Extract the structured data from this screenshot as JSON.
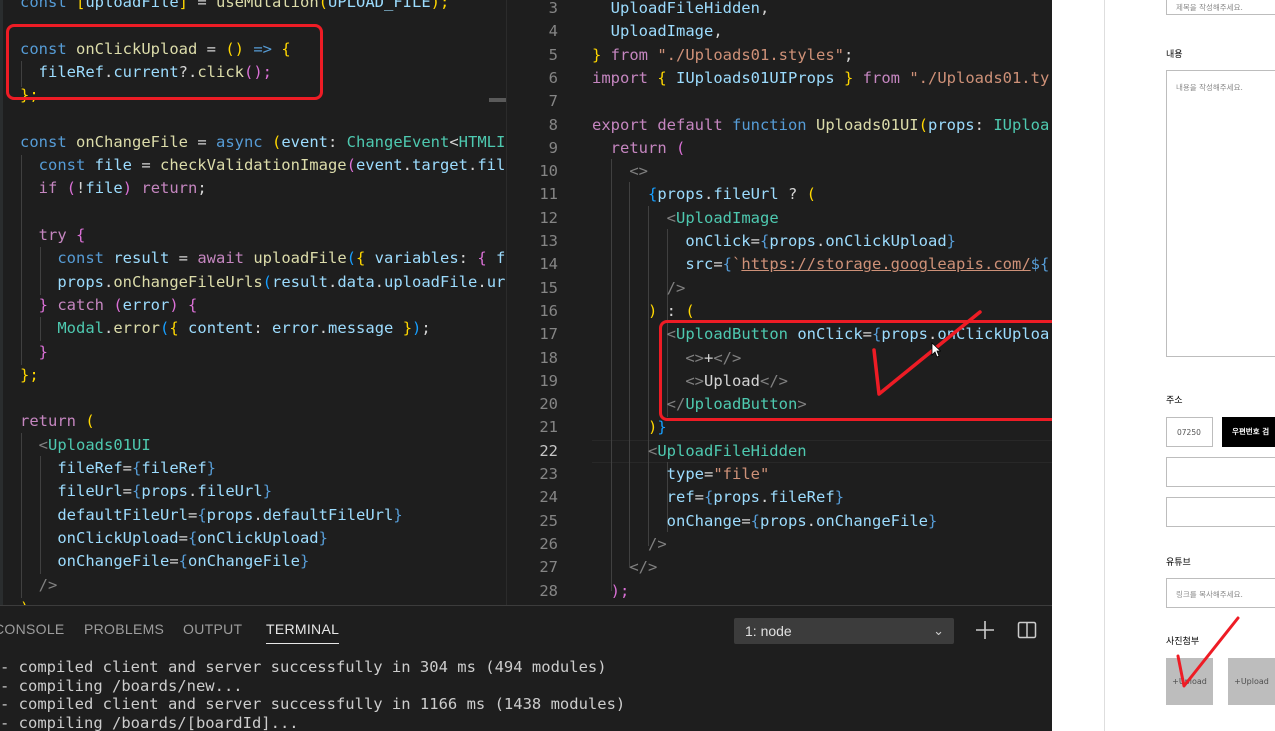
{
  "left_editor": {
    "lines": [
      [
        [
          "const ",
          "k"
        ],
        [
          "[",
          "y"
        ],
        [
          "uploadFile",
          "v"
        ],
        [
          "]",
          "y"
        ],
        [
          " = ",
          "p"
        ],
        [
          "useMutation",
          "f"
        ],
        [
          "(",
          "y"
        ],
        [
          "UPLOAD_FILE",
          "v"
        ],
        [
          ");",
          "y"
        ]
      ],
      [],
      [
        [
          "const ",
          "k"
        ],
        [
          "onClickUpload",
          "f"
        ],
        [
          " = ",
          "p"
        ],
        [
          "()",
          "y"
        ],
        [
          " => ",
          "k"
        ],
        [
          "{",
          "y"
        ]
      ],
      [
        [
          "  fileRef",
          "v"
        ],
        [
          ".",
          "p"
        ],
        [
          "current",
          "v"
        ],
        [
          "?.",
          "p"
        ],
        [
          "click",
          "f"
        ],
        [
          "();",
          "pk"
        ]
      ],
      [
        [
          "};",
          "y"
        ]
      ],
      [],
      [
        [
          "const ",
          "k"
        ],
        [
          "onChangeFile",
          "f"
        ],
        [
          " = ",
          "p"
        ],
        [
          "async ",
          "k"
        ],
        [
          "(",
          "y"
        ],
        [
          "event",
          "v"
        ],
        [
          ": ",
          "p"
        ],
        [
          "ChangeEvent",
          "t"
        ],
        [
          "<",
          "p"
        ],
        [
          "HTMLI",
          "t"
        ]
      ],
      [
        [
          "  const ",
          "k"
        ],
        [
          "file",
          "v"
        ],
        [
          " = ",
          "p"
        ],
        [
          "checkValidationImage",
          "f"
        ],
        [
          "(",
          "pk"
        ],
        [
          "event",
          "v"
        ],
        [
          ".",
          "p"
        ],
        [
          "target",
          "v"
        ],
        [
          ".",
          "p"
        ],
        [
          "fil",
          "v"
        ]
      ],
      [
        [
          "  if ",
          "kc"
        ],
        [
          "(",
          "pk"
        ],
        [
          "!",
          "p"
        ],
        [
          "file",
          "v"
        ],
        [
          ") ",
          "pk"
        ],
        [
          "return",
          "kc"
        ],
        [
          ";",
          "p"
        ]
      ],
      [],
      [
        [
          "  try ",
          "kc"
        ],
        [
          "{",
          "pk"
        ]
      ],
      [
        [
          "    const ",
          "k"
        ],
        [
          "result",
          "v"
        ],
        [
          " = ",
          "p"
        ],
        [
          "await ",
          "kc"
        ],
        [
          "uploadFile",
          "f"
        ],
        [
          "(",
          "bl"
        ],
        [
          "{ ",
          "y"
        ],
        [
          "variables",
          "v"
        ],
        [
          ": ",
          "p"
        ],
        [
          "{ ",
          "pk"
        ],
        [
          "f",
          "v"
        ]
      ],
      [
        [
          "    props",
          "v"
        ],
        [
          ".",
          "p"
        ],
        [
          "onChangeFileUrls",
          "f"
        ],
        [
          "(",
          "bl"
        ],
        [
          "result",
          "v"
        ],
        [
          ".",
          "p"
        ],
        [
          "data",
          "v"
        ],
        [
          ".",
          "p"
        ],
        [
          "uploadFile",
          "v"
        ],
        [
          ".",
          "p"
        ],
        [
          "ur",
          "v"
        ]
      ],
      [
        [
          "  } ",
          "pk"
        ],
        [
          "catch ",
          "kc"
        ],
        [
          "(",
          "pk"
        ],
        [
          "error",
          "v"
        ],
        [
          ") ",
          "pk"
        ],
        [
          "{",
          "pk"
        ]
      ],
      [
        [
          "    Modal",
          "t"
        ],
        [
          ".",
          "p"
        ],
        [
          "error",
          "f"
        ],
        [
          "(",
          "bl"
        ],
        [
          "{ ",
          "y"
        ],
        [
          "content",
          "v"
        ],
        [
          ": ",
          "p"
        ],
        [
          "error",
          "v"
        ],
        [
          ".",
          "p"
        ],
        [
          "message",
          "v"
        ],
        [
          " }",
          "y"
        ],
        [
          ")",
          "bl"
        ],
        [
          ";",
          "p"
        ]
      ],
      [
        [
          "  }",
          "pk"
        ]
      ],
      [
        [
          "};",
          "y"
        ]
      ],
      [],
      [
        [
          "return ",
          "kc"
        ],
        [
          "(",
          "y"
        ]
      ],
      [
        [
          "  <",
          "g"
        ],
        [
          "Uploads01UI",
          "t"
        ]
      ],
      [
        [
          "    fileRef",
          "v"
        ],
        [
          "=",
          "p"
        ],
        [
          "{",
          "k"
        ],
        [
          "fileRef",
          "v"
        ],
        [
          "}",
          "k"
        ]
      ],
      [
        [
          "    fileUrl",
          "v"
        ],
        [
          "=",
          "p"
        ],
        [
          "{",
          "k"
        ],
        [
          "props",
          "v"
        ],
        [
          ".",
          "p"
        ],
        [
          "fileUrl",
          "v"
        ],
        [
          "}",
          "k"
        ]
      ],
      [
        [
          "    defaultFileUrl",
          "v"
        ],
        [
          "=",
          "p"
        ],
        [
          "{",
          "k"
        ],
        [
          "props",
          "v"
        ],
        [
          ".",
          "p"
        ],
        [
          "defaultFileUrl",
          "v"
        ],
        [
          "}",
          "k"
        ]
      ],
      [
        [
          "    onClickUpload",
          "v"
        ],
        [
          "=",
          "p"
        ],
        [
          "{",
          "k"
        ],
        [
          "onClickUpload",
          "v"
        ],
        [
          "}",
          "k"
        ]
      ],
      [
        [
          "    onChangeFile",
          "v"
        ],
        [
          "=",
          "p"
        ],
        [
          "{",
          "k"
        ],
        [
          "onChangeFile",
          "v"
        ],
        [
          "}",
          "k"
        ]
      ],
      [
        [
          "  />",
          "g"
        ]
      ],
      [
        [
          ")",
          "y"
        ]
      ]
    ]
  },
  "right_editor": {
    "line_numbers": [
      "3",
      "4",
      "5",
      "6",
      "7",
      "8",
      "9",
      "10",
      "11",
      "12",
      "13",
      "14",
      "15",
      "16",
      "17",
      "18",
      "19",
      "20",
      "21",
      "22",
      "23",
      "24",
      "25",
      "26",
      "27",
      "28"
    ],
    "active_line": "22",
    "lines": [
      [
        [
          "  UploadFileHidden",
          "v"
        ],
        [
          ",",
          "p"
        ]
      ],
      [
        [
          "  UploadImage",
          "v"
        ],
        [
          ",",
          "p"
        ]
      ],
      [
        [
          "} ",
          "y"
        ],
        [
          "from ",
          "kc"
        ],
        [
          "\"./Uploads01.styles\"",
          "s"
        ],
        [
          ";",
          "p"
        ]
      ],
      [
        [
          "import ",
          "kc"
        ],
        [
          "{ ",
          "y"
        ],
        [
          "IUploads01UIProps ",
          "v"
        ],
        [
          "} ",
          "y"
        ],
        [
          "from ",
          "kc"
        ],
        [
          "\"./Uploads01.ty",
          "s"
        ]
      ],
      [],
      [
        [
          "export ",
          "kc"
        ],
        [
          "default ",
          "kc"
        ],
        [
          "function ",
          "k"
        ],
        [
          "Uploads01UI",
          "f"
        ],
        [
          "(",
          "y"
        ],
        [
          "props",
          "v"
        ],
        [
          ": ",
          "p"
        ],
        [
          "IUploa",
          "t"
        ]
      ],
      [
        [
          "  return ",
          "kc"
        ],
        [
          "(",
          "pk"
        ]
      ],
      [
        [
          "    <>",
          "g"
        ]
      ],
      [
        [
          "      {",
          "bl"
        ],
        [
          "props",
          "v"
        ],
        [
          ".",
          "p"
        ],
        [
          "fileUrl ",
          "v"
        ],
        [
          "? ",
          "p"
        ],
        [
          "(",
          "y"
        ]
      ],
      [
        [
          "        <",
          "g"
        ],
        [
          "UploadImage",
          "t"
        ]
      ],
      [
        [
          "          onClick",
          "v"
        ],
        [
          "=",
          "p"
        ],
        [
          "{",
          "k"
        ],
        [
          "props",
          "v"
        ],
        [
          ".",
          "p"
        ],
        [
          "onClickUpload",
          "v"
        ],
        [
          "}",
          "k"
        ]
      ],
      [
        [
          "          src",
          "v"
        ],
        [
          "=",
          "p"
        ],
        [
          "{",
          "k"
        ],
        [
          "`",
          "s"
        ],
        [
          "https://storage.googleapis.com/",
          "link"
        ],
        [
          "${",
          "k"
        ]
      ],
      [
        [
          "        />",
          "g"
        ]
      ],
      [
        [
          "      ) ",
          "y"
        ],
        [
          ": ",
          "p"
        ],
        [
          "(",
          "y"
        ]
      ],
      [
        [
          "        <",
          "g"
        ],
        [
          "UploadButton ",
          "t"
        ],
        [
          "onClick",
          "v"
        ],
        [
          "=",
          "p"
        ],
        [
          "{",
          "k"
        ],
        [
          "props",
          "v"
        ],
        [
          ".",
          "p"
        ],
        [
          "onClickUploa",
          "v"
        ]
      ],
      [
        [
          "          <>",
          "g"
        ],
        [
          "+",
          "p"
        ],
        [
          "</>",
          "g"
        ]
      ],
      [
        [
          "          <>",
          "g"
        ],
        [
          "Upload",
          "p"
        ],
        [
          "</>",
          "g"
        ]
      ],
      [
        [
          "        </",
          "g"
        ],
        [
          "UploadButton",
          "t"
        ],
        [
          ">",
          "g"
        ]
      ],
      [
        [
          "      )",
          "y"
        ],
        [
          "}",
          "bl"
        ]
      ],
      [
        [
          "      <",
          "g"
        ],
        [
          "UploadFileHidden",
          "t"
        ]
      ],
      [
        [
          "        type",
          "v"
        ],
        [
          "=",
          "p"
        ],
        [
          "\"file\"",
          "s"
        ]
      ],
      [
        [
          "        ref",
          "v"
        ],
        [
          "=",
          "p"
        ],
        [
          "{",
          "k"
        ],
        [
          "props",
          "v"
        ],
        [
          ".",
          "p"
        ],
        [
          "fileRef",
          "v"
        ],
        [
          "}",
          "k"
        ]
      ],
      [
        [
          "        onChange",
          "v"
        ],
        [
          "=",
          "p"
        ],
        [
          "{",
          "k"
        ],
        [
          "props",
          "v"
        ],
        [
          ".",
          "p"
        ],
        [
          "onChangeFile",
          "v"
        ],
        [
          "}",
          "k"
        ]
      ],
      [
        [
          "      />",
          "g"
        ]
      ],
      [
        [
          "    </>",
          "g"
        ]
      ],
      [
        [
          "  );",
          "pk"
        ]
      ]
    ]
  },
  "panel": {
    "tabs": [
      "CONSOLE",
      "PROBLEMS",
      "OUTPUT",
      "TERMINAL"
    ],
    "active_tab": "TERMINAL",
    "terminal_select": "1: node",
    "terminal_lines": [
      "- compiled client and server successfully in 304 ms (494 modules)",
      "- compiling /boards/new...",
      "- compiled client and server successfully in 1166 ms (1438 modules)",
      "- compiling /boards/[boardId]..."
    ]
  },
  "browser": {
    "title_placeholder": "제목을 작성해주세요.",
    "content_label": "내용",
    "content_placeholder": "내용을 작성해주세요.",
    "address_label": "주소",
    "zipcode_value": "07250",
    "zipcode_button": "우편번호 검",
    "youtube_label": "유튜브",
    "youtube_placeholder": "링크를 복사해주세요.",
    "photo_label": "사진첨부",
    "upload_buttons": [
      "+Upload",
      "+Upload"
    ]
  },
  "colors": {
    "annotation_red": "#ee1c25",
    "editor_bg": "#1e1e1e"
  }
}
